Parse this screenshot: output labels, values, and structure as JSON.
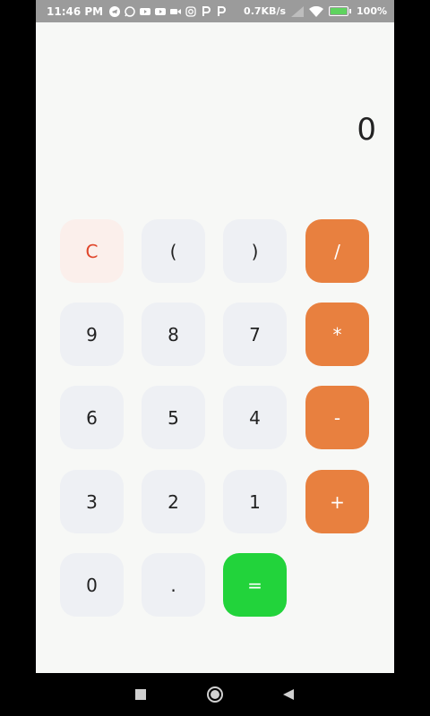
{
  "status_bar": {
    "time": "11:46 PM",
    "network_speed": "0.7KB/s",
    "battery_percent": "100%",
    "battery_level": 1.0,
    "icons": [
      "telegram-icon",
      "whatsapp-icon",
      "youtube-icon",
      "youtube-icon",
      "video-icon",
      "instagram-icon",
      "p-icon",
      "p-icon",
      "signal-icon",
      "wifi-icon",
      "battery-icon"
    ]
  },
  "display": {
    "value": "0"
  },
  "keys": {
    "clear": "C",
    "lparen": "(",
    "rparen": ")",
    "divide": "/",
    "nine": "9",
    "eight": "8",
    "seven": "7",
    "multiply": "*",
    "six": "6",
    "five": "5",
    "four": "4",
    "minus": "-",
    "three": "3",
    "two": "2",
    "one": "1",
    "plus": "+",
    "zero": "0",
    "dot": ".",
    "equals": "="
  },
  "colors": {
    "app_bg": "#f7f8f6",
    "key_bg": "#eef0f4",
    "clear_bg": "#fbefeb",
    "clear_text": "#e0452a",
    "operator_bg": "#e8803f",
    "equals_bg": "#22d33b"
  },
  "navigation": {
    "icons": [
      "square-recents-icon",
      "circle-home-icon",
      "triangle-back-icon"
    ]
  }
}
